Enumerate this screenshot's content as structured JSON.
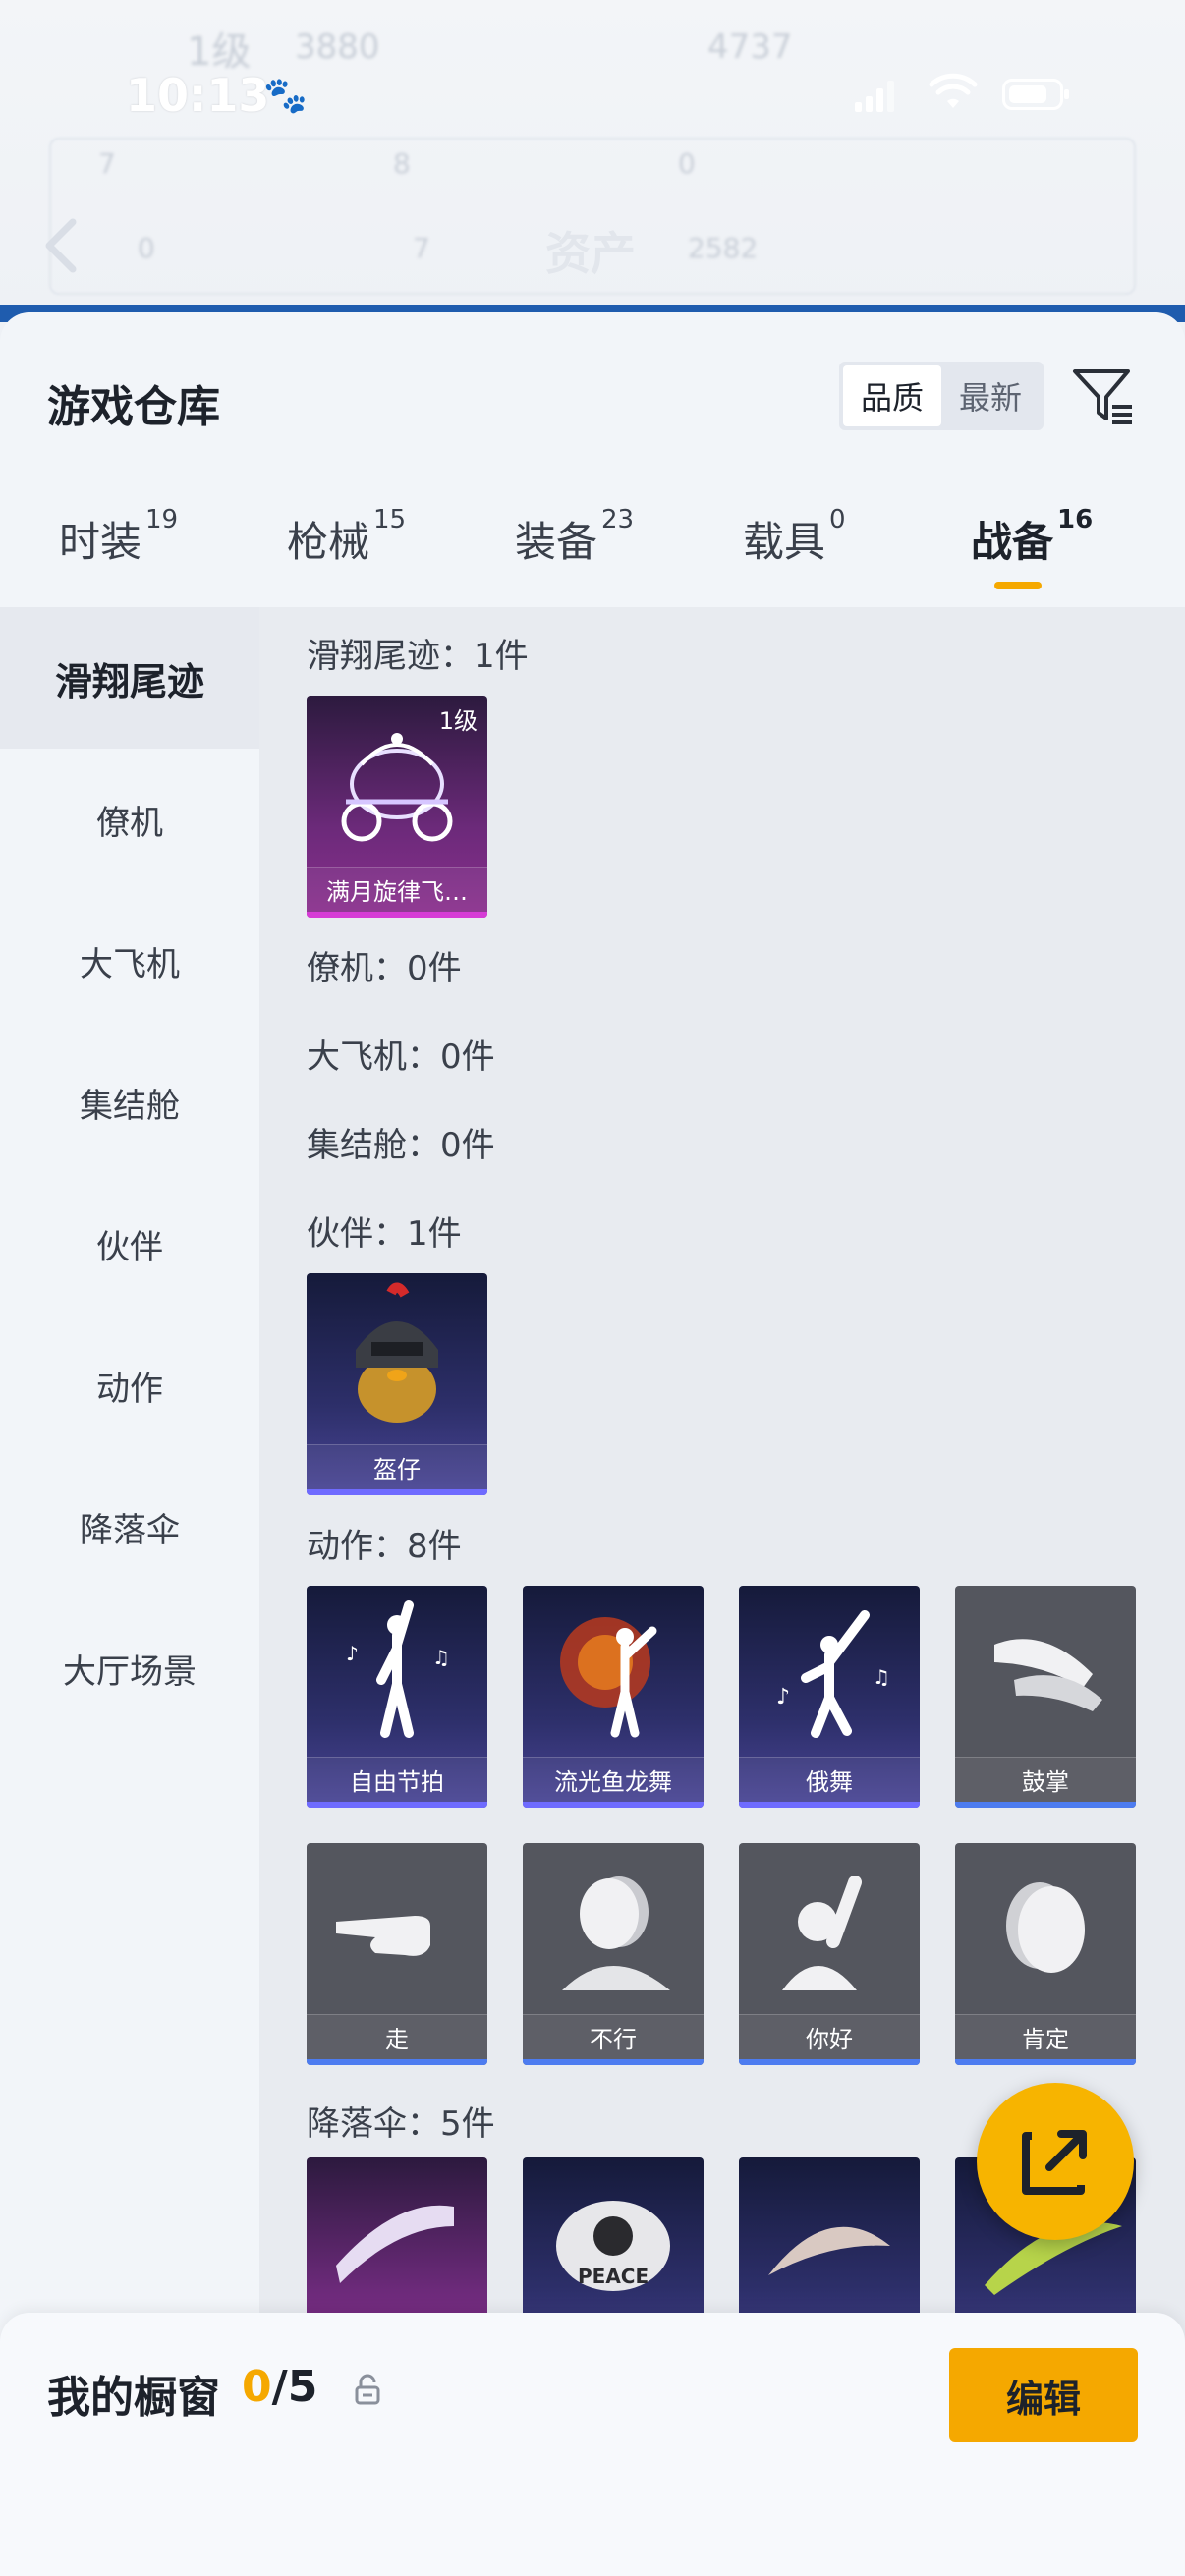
{
  "status": {
    "time": "10:13"
  },
  "topbar": {
    "title": "资产"
  },
  "header": {
    "title": "游戏仓库",
    "sort": {
      "quality": "品质",
      "newest": "最新"
    }
  },
  "tabs": [
    {
      "label": "时装",
      "count": "19"
    },
    {
      "label": "枪械",
      "count": "15"
    },
    {
      "label": "装备",
      "count": "23"
    },
    {
      "label": "载具",
      "count": "0"
    },
    {
      "label": "战备",
      "count": "16"
    }
  ],
  "sidebar": {
    "items": [
      {
        "label": "滑翔尾迹"
      },
      {
        "label": "僚机"
      },
      {
        "label": "大飞机"
      },
      {
        "label": "集结舱"
      },
      {
        "label": "伙伴"
      },
      {
        "label": "动作"
      },
      {
        "label": "降落伞"
      },
      {
        "label": "大厅场景"
      }
    ]
  },
  "sections": {
    "glide": "滑翔尾迹：1件",
    "wingman": "僚机：0件",
    "plane": "大飞机：0件",
    "capsule": "集结舱：0件",
    "partner": "伙伴：1件",
    "emote": "动作：8件",
    "parachute": "降落伞：5件"
  },
  "items": {
    "glide": [
      {
        "name": "满月旋律飞…",
        "level": "1级"
      }
    ],
    "partner": [
      {
        "name": "盔仔"
      }
    ],
    "emote": [
      {
        "name": "自由节拍"
      },
      {
        "name": "流光鱼龙舞"
      },
      {
        "name": "俄舞"
      },
      {
        "name": "鼓掌"
      },
      {
        "name": "走"
      },
      {
        "name": "不行"
      },
      {
        "name": "你好"
      },
      {
        "name": "肯定"
      }
    ]
  },
  "bottom": {
    "title": "我的橱窗",
    "count_current": "0",
    "count_total": "/5",
    "edit_label": "编辑"
  },
  "colors": {
    "accent": "#f5a800",
    "rare_purple": "#d63cd6",
    "epic_blue": "#6f6bff",
    "common_blue": "#4d7cf0"
  }
}
